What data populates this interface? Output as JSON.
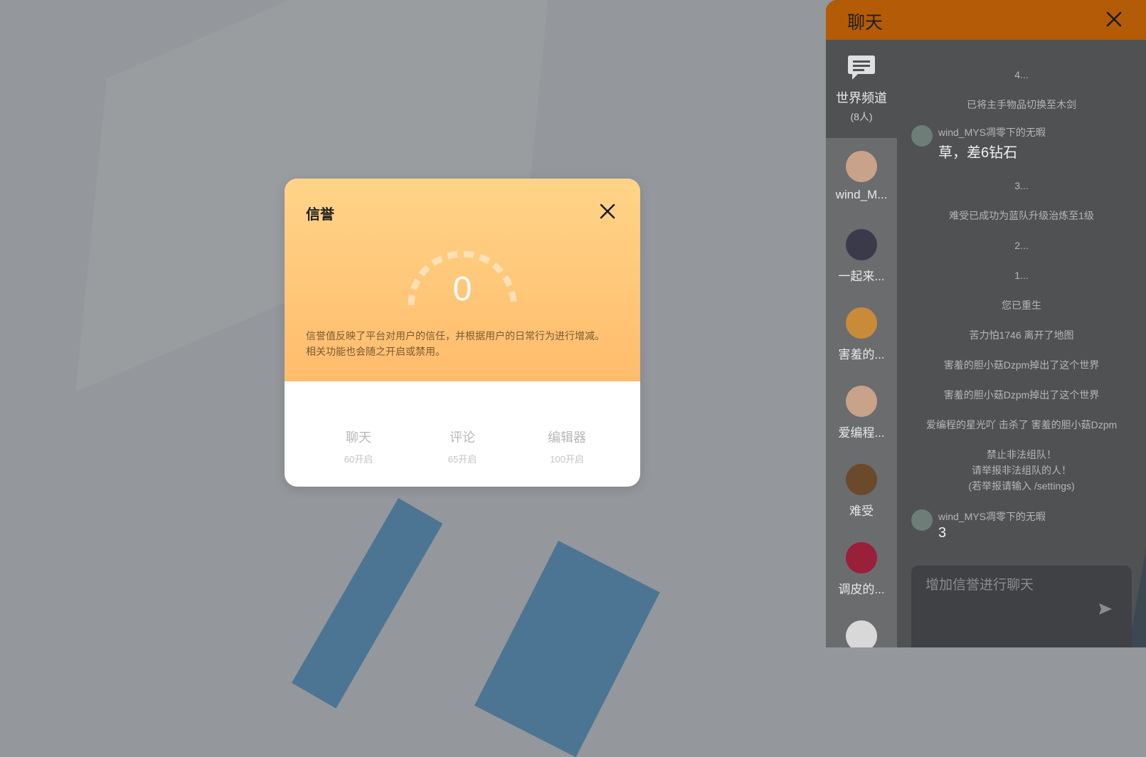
{
  "credit_modal": {
    "title": "信誉",
    "score": "0",
    "description": "信誉值反映了平台对用户的信任，并根据用户的日常行为进行增减。相关功能也会随之开启或禁用。",
    "features": [
      {
        "name": "聊天",
        "requirement": "60开启"
      },
      {
        "name": "评论",
        "requirement": "65开启"
      },
      {
        "name": "编辑器",
        "requirement": "100开启"
      }
    ]
  },
  "chat": {
    "title": "聊天",
    "channel": {
      "name": "世界频道",
      "count": "(8人)",
      "icon": "chat-bubble-icon"
    },
    "users": [
      {
        "name": "wind_M...",
        "avatar_color": "#c9a28a"
      },
      {
        "name": "一起来...",
        "avatar_color": "#3a3a4a"
      },
      {
        "name": "害羞的...",
        "avatar_color": "#c98b3a"
      },
      {
        "name": "爱编程...",
        "avatar_color": "#c9a28a"
      },
      {
        "name": "难受",
        "avatar_color": "#6a4a2a"
      },
      {
        "name": "调皮的...",
        "avatar_color": "#9a1f3a"
      }
    ],
    "messages": [
      {
        "type": "system",
        "text": "4..."
      },
      {
        "type": "system",
        "text": "已将主手物品切换至木剑"
      },
      {
        "type": "user",
        "user": "wind_MYS凋零下的无暇",
        "text": "草，差6钻石"
      },
      {
        "type": "system",
        "text": "3..."
      },
      {
        "type": "system",
        "text": "难受已成功为蓝队升级治炼至1级"
      },
      {
        "type": "system",
        "text": "2..."
      },
      {
        "type": "system",
        "text": "1..."
      },
      {
        "type": "system",
        "text": "您已重生"
      },
      {
        "type": "system",
        "text": "苦力怕1746 离开了地图"
      },
      {
        "type": "system",
        "text": "害羞的胆小菇Dzpm掉出了这个世界"
      },
      {
        "type": "system",
        "text": "害羞的胆小菇Dzpm掉出了这个世界"
      },
      {
        "type": "system",
        "text": "爱编程的星光吖 击杀了 害羞的胆小菇Dzpm"
      },
      {
        "type": "system",
        "text": "禁止非法组队！"
      },
      {
        "type": "system",
        "text": "请举报非法组队的人！"
      },
      {
        "type": "system",
        "text": "(若举报请输入 /settings)"
      },
      {
        "type": "user",
        "user": "wind_MYS凋零下的无暇",
        "text": "3"
      }
    ],
    "input_placeholder": "增加信誉进行聊天"
  },
  "colors": {
    "header": "#b35b06",
    "modal_gradient_top": "#ffd488",
    "modal_gradient_bottom": "#ffbc6c",
    "background": "#94979b"
  }
}
